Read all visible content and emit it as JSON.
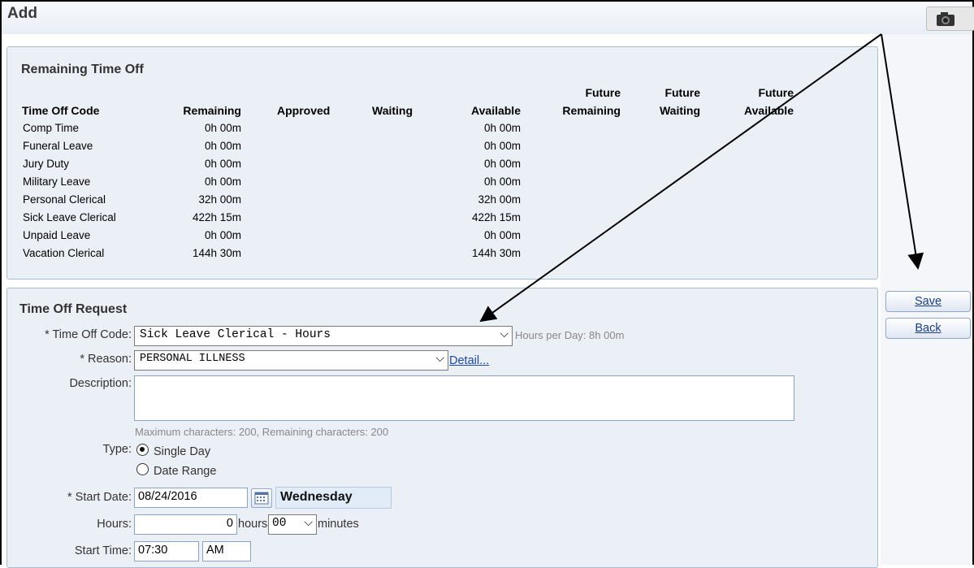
{
  "header": {
    "title": "Add",
    "camera_icon": "camera-icon"
  },
  "remaining": {
    "heading": "Remaining Time Off",
    "columns": [
      {
        "line1": "",
        "line2": "Time Off Code"
      },
      {
        "line1": "",
        "line2": "Remaining"
      },
      {
        "line1": "",
        "line2": "Approved"
      },
      {
        "line1": "",
        "line2": "Waiting"
      },
      {
        "line1": "",
        "line2": "Available"
      },
      {
        "line1": "Future",
        "line2": "Remaining"
      },
      {
        "line1": "Future",
        "line2": "Waiting"
      },
      {
        "line1": "Future",
        "line2": "Available"
      }
    ],
    "rows": [
      {
        "code": "Comp Time",
        "remaining": "0h 00m",
        "available": "0h 00m"
      },
      {
        "code": "Funeral Leave",
        "remaining": "0h 00m",
        "available": "0h 00m"
      },
      {
        "code": "Jury Duty",
        "remaining": "0h 00m",
        "available": "0h 00m"
      },
      {
        "code": "Military Leave",
        "remaining": "0h 00m",
        "available": "0h 00m"
      },
      {
        "code": "Personal Clerical",
        "remaining": "32h 00m",
        "available": "32h 00m"
      },
      {
        "code": "Sick Leave Clerical",
        "remaining": "422h 15m",
        "available": "422h 15m"
      },
      {
        "code": "Unpaid Leave",
        "remaining": "0h 00m",
        "available": "0h 00m"
      },
      {
        "code": "Vacation Clerical",
        "remaining": "144h 30m",
        "available": "144h 30m"
      }
    ]
  },
  "request": {
    "heading": "Time Off Request",
    "time_off_code_label": "* Time Off Code:",
    "time_off_code_value": "Sick Leave Clerical - Hours",
    "hours_per_day": "Hours per Day: 8h 00m",
    "reason_label": "* Reason:",
    "reason_value": "PERSONAL ILLNESS",
    "detail_link": "Detail...",
    "description_label": "Description:",
    "description_value": "",
    "description_hint": "Maximum characters: 200, Remaining characters: 200",
    "type_label": "Type:",
    "type_single": "Single Day",
    "type_range": "Date Range",
    "type_selected": "Single Day",
    "start_date_label": "* Start Date:",
    "start_date_value": "08/24/2016",
    "weekday": "Wednesday",
    "hours_label": "Hours:",
    "hours_value": "0",
    "hours_unit": "hours",
    "minutes_value": "00",
    "minutes_unit": "minutes",
    "start_time_label": "Start Time:",
    "start_time_value": "07:30",
    "ampm_value": "AM"
  },
  "actions": {
    "save": "Save",
    "back": "Back"
  }
}
